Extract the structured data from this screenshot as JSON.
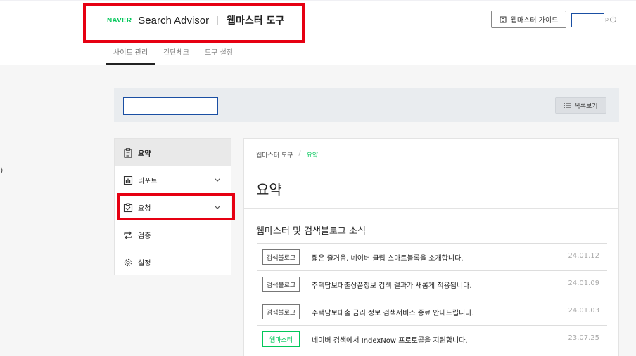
{
  "header": {
    "brand_logo": "NAVER",
    "brand_title": "Search Advisor",
    "brand_sub": "웹마스터 도구",
    "guide_label": "웹마스터 가이드",
    "dot": "p"
  },
  "tabs": [
    {
      "label": "사이트 관리"
    },
    {
      "label": "간단체크"
    },
    {
      "label": "도구 설정"
    }
  ],
  "toolbar": {
    "list_label": "목록보기"
  },
  "sidebar": {
    "items": [
      {
        "label": "요약",
        "icon": "clipboard-icon"
      },
      {
        "label": "리포트",
        "icon": "chart-icon"
      },
      {
        "label": "요청",
        "icon": "checkbox-icon"
      },
      {
        "label": "검증",
        "icon": "repeat-icon"
      },
      {
        "label": "설정",
        "icon": "gear-icon"
      }
    ]
  },
  "breadcrumb": {
    "root": "웹마스터 도구",
    "sep": "/",
    "current": "요약"
  },
  "main": {
    "title": "요약",
    "news_title": "웹마스터 및 검색블로그 소식",
    "news": [
      {
        "badge": "검색블로그",
        "text": "짧은 즐거움, 네이버 클립 스마트블록을 소개합니다.",
        "date": "24.01.12"
      },
      {
        "badge": "검색블로그",
        "text": "주택담보대출상품정보 검색 결과가 새롭게 적용됩니다.",
        "date": "24.01.09"
      },
      {
        "badge": "검색블로그",
        "text": "주택담보대출 금리 정보 검색서비스 종료 안내드립니다.",
        "date": "24.01.03"
      },
      {
        "badge": "웹마스터",
        "text": "네이버 검색에서 IndexNow 프로토콜을 지원합니다.",
        "date": "23.07.25"
      }
    ]
  },
  "misc": {
    "left_mark": ")"
  },
  "colors": {
    "naver_green": "#03c75a",
    "highlight_red": "#e60012",
    "input_border": "#1a4fa3"
  }
}
